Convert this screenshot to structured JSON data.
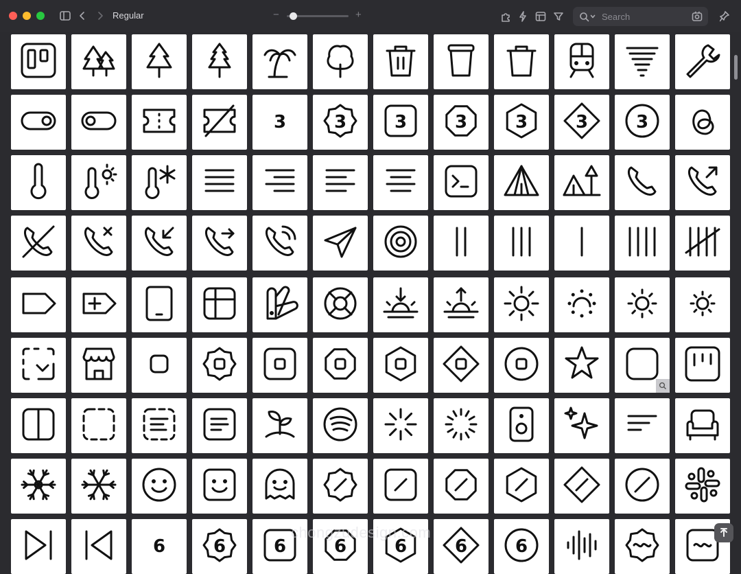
{
  "window": {
    "title": "Regular",
    "zoom_level": 0.05,
    "search_placeholder": "Search",
    "watermark": "chongzudesign.com"
  },
  "toolbar": {
    "left_icons": [
      "sidebar-toggle-icon",
      "back-icon",
      "forward-icon"
    ],
    "right_icons": [
      "puzzle-icon",
      "bolt-icon",
      "layout-icon",
      "filter-icon"
    ],
    "search_icons": [
      "magnifier-icon",
      "chevron-down-icon",
      "scan-icon"
    ],
    "pin_icon": "pin-icon"
  },
  "colors": {
    "window_bg": "#2b2b2f",
    "tile_bg": "#ffffff",
    "icon_stroke": "#111111",
    "close": "#ff5f57",
    "minimize": "#febc2e",
    "zoom": "#28c840"
  },
  "rows": [
    {
      "icons": [
        "trello-icon",
        "trees-icon",
        "tree-pine-icon",
        "tree-evergreen-icon",
        "tree-palm-icon",
        "tree-deciduous-icon",
        "trash-2-icon",
        "trash-can-icon",
        "trash-icon",
        "train-front-icon",
        "tornado-icon",
        "wrench-icon"
      ]
    },
    {
      "icons": [
        "toggle-right-icon",
        "toggle-left-icon",
        "ticket-icon",
        "ticket-slash-icon",
        "three-icon",
        "badge-three-icon",
        "square-three-icon",
        "octagon-three-icon",
        "hexagon-three-icon",
        "diamond-three-icon",
        "circle-three-icon",
        "threads-icon"
      ],
      "texts": {
        "4": "3",
        "5": "3",
        "6": "3",
        "7": "3",
        "8": "3",
        "9": "3",
        "10": "3"
      }
    },
    {
      "icons": [
        "thermometer-icon",
        "thermometer-sun-icon",
        "thermometer-snowflake-icon",
        "text-align-justify-icon",
        "text-align-end-icon",
        "text-align-start-icon",
        "text-align-center-icon",
        "terminal-square-icon",
        "tent-icon",
        "tent-tree-icon",
        "phone-icon",
        "phone-outgoing-icon"
      ]
    },
    {
      "icons": [
        "phone-off-icon",
        "phone-missed-icon",
        "phone-incoming-icon",
        "phone-forwarded-icon",
        "phone-call-icon",
        "send-icon",
        "target-icon",
        "tally-2-icon",
        "tally-3-icon",
        "tally-1-icon",
        "tally-4-icon",
        "tally-5-icon"
      ]
    },
    {
      "icons": [
        "tag-icon",
        "tag-plus-icon",
        "tablet-icon",
        "table-grid-icon",
        "swatch-book-icon",
        "life-buoy-icon",
        "sunset-icon",
        "sunrise-icon",
        "sun-icon",
        "sun-dim-icon",
        "sun-medium-icon",
        "sun-small-icon"
      ]
    },
    {
      "icons": [
        "square-dashed-corner-icon",
        "store-icon",
        "stop-icon",
        "badge-stop-icon",
        "square-stop-icon",
        "octagon-stop-icon",
        "hexagon-stop-icon",
        "diamond-stop-icon",
        "circle-stop-icon",
        "star-icon",
        "square-icon",
        "squares-kanban-icon"
      ]
    },
    {
      "icons": [
        "columns-2-icon",
        "square-dashed-icon",
        "square-dashed-text-icon",
        "square-text-icon",
        "sprout-icon",
        "spotify-icon",
        "loader-icon",
        "loader-circle-icon",
        "speaker-icon",
        "sparkles-icon",
        "text-left-icon",
        "sofa-icon"
      ]
    },
    {
      "icons": [
        "snowflake-icon",
        "snowflake-thin-icon",
        "smile-icon",
        "smile-square-icon",
        "ghost-smile-icon",
        "badge-slash-icon",
        "square-slash-icon",
        "octagon-slash-icon",
        "hexagon-slash-icon",
        "diamond-slash-icon",
        "circle-slash-icon",
        "slack-icon"
      ]
    },
    {
      "icons": [
        "skip-forward-icon",
        "skip-back-icon",
        "six-icon",
        "badge-six-icon",
        "square-six-icon",
        "octagon-six-icon",
        "hexagon-six-icon",
        "diamond-six-icon",
        "circle-six-icon",
        "audio-lines-icon",
        "badge-wave-icon",
        "square-wave-icon"
      ],
      "texts": {
        "2": "6",
        "3": "6",
        "4": "6",
        "5": "6",
        "6": "6",
        "7": "6",
        "8": "6"
      }
    }
  ]
}
